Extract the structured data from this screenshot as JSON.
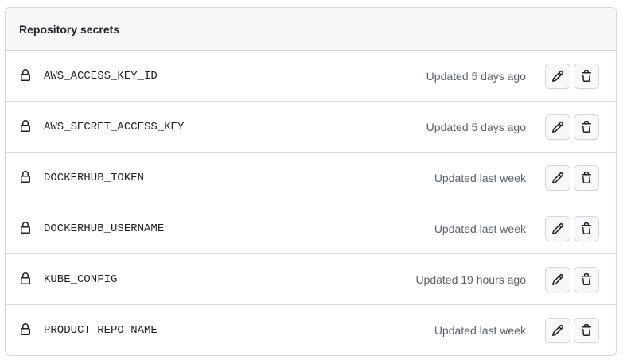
{
  "panel": {
    "title": "Repository secrets"
  },
  "secrets": [
    {
      "name": "AWS_ACCESS_KEY_ID",
      "updated": "Updated 5 days ago"
    },
    {
      "name": "AWS_SECRET_ACCESS_KEY",
      "updated": "Updated 5 days ago"
    },
    {
      "name": "DOCKERHUB_TOKEN",
      "updated": "Updated last week"
    },
    {
      "name": "DOCKERHUB_USERNAME",
      "updated": "Updated last week"
    },
    {
      "name": "KUBE_CONFIG",
      "updated": "Updated 19 hours ago"
    },
    {
      "name": "PRODUCT_REPO_NAME",
      "updated": "Updated last week"
    }
  ],
  "icons": {
    "row_icon": "lock-icon",
    "edit_icon": "pencil-icon",
    "delete_icon": "trash-icon"
  },
  "colors": {
    "border": "#d0d7de",
    "header_bg": "#f6f8fa",
    "text": "#1f2328",
    "muted": "#59636e"
  }
}
